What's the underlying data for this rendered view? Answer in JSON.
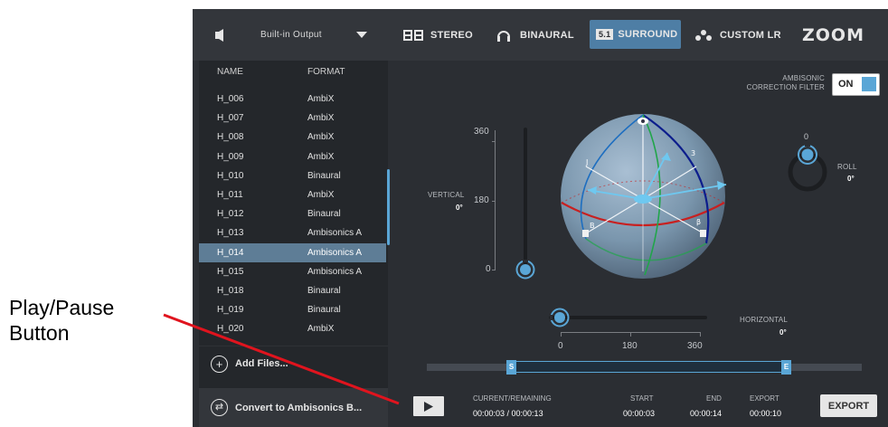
{
  "annotation": {
    "label_line1": "Play/Pause",
    "label_line2": "Button"
  },
  "topbar": {
    "output_device": "Built-in Output",
    "modes": [
      {
        "label": "STEREO",
        "icon": "stereo-icon"
      },
      {
        "label": "BINAURAL",
        "icon": "headphones-icon"
      },
      {
        "label": "SURROUND",
        "badge": "5.1",
        "icon": "surround-badge",
        "active": true
      },
      {
        "label": "CUSTOM LR",
        "icon": "custom-lr-icon"
      }
    ],
    "logo": "ZOOM"
  },
  "file_list": {
    "col_name": "NAME",
    "col_format": "FORMAT",
    "rows": [
      {
        "name": "H_006",
        "format": "AmbiX"
      },
      {
        "name": "H_007",
        "format": "AmbiX"
      },
      {
        "name": "H_008",
        "format": "AmbiX"
      },
      {
        "name": "H_009",
        "format": "AmbiX"
      },
      {
        "name": "H_010",
        "format": "Binaural"
      },
      {
        "name": "H_011",
        "format": "AmbiX"
      },
      {
        "name": "H_012",
        "format": "Binaural"
      },
      {
        "name": "H_013",
        "format": "Ambisonics A"
      },
      {
        "name": "H_014",
        "format": "Ambisonics A",
        "selected": true
      },
      {
        "name": "H_015",
        "format": "Ambisonics A"
      },
      {
        "name": "H_018",
        "format": "Binaural"
      },
      {
        "name": "H_019",
        "format": "Binaural"
      },
      {
        "name": "H_020",
        "format": "AmbiX"
      }
    ],
    "add_files": "Add Files...",
    "convert": "Convert to Ambisonics B..."
  },
  "correction": {
    "label_line1": "AMBISONIC",
    "label_line2": "CORRECTION FILTER",
    "toggle": "ON"
  },
  "vertical": {
    "label": "VERTICAL",
    "value": "0°",
    "ticks": [
      "360",
      "180",
      "0"
    ]
  },
  "horizontal": {
    "label": "HORIZONTAL",
    "value": "0°",
    "ticks": [
      "0",
      "180",
      "360"
    ]
  },
  "roll": {
    "label": "ROLL",
    "value": "0°",
    "top_tick": "0"
  },
  "timeline": {
    "start_marker": "S",
    "end_marker": "E"
  },
  "transport": {
    "current_label": "CURRENT/REMAINING",
    "current_value": "00:00:03 / 00:00:13",
    "start_label": "START",
    "start_value": "00:00:03",
    "end_label": "END",
    "end_value": "00:00:14",
    "export_label": "EXPORT",
    "export_value": "00:00:10",
    "export_button": "EXPORT"
  },
  "colors": {
    "accent": "#5aa6d6",
    "background": "#2b2e33",
    "selected_row": "#5e7d96",
    "annotation_line": "#e0141e"
  }
}
